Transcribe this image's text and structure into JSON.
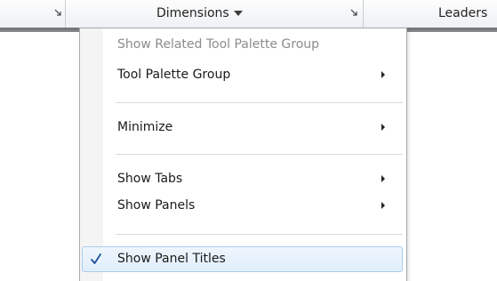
{
  "ribbon": {
    "panels": [
      {
        "title": "",
        "launcher_icon": "panel-launcher-icon"
      },
      {
        "title": "Dimensions",
        "dropdown_icon": "dropdown-arrow-icon",
        "launcher_icon": "panel-launcher-icon"
      },
      {
        "title": "Leaders"
      }
    ]
  },
  "context_menu": {
    "items": [
      {
        "label": "Show Related Tool Palette Group",
        "enabled": false,
        "submenu": false,
        "checked": false
      },
      {
        "label": "Tool Palette Group",
        "enabled": true,
        "submenu": true,
        "checked": false
      },
      {
        "label": "Minimize",
        "enabled": true,
        "submenu": true,
        "checked": false
      },
      {
        "label": "Show Tabs",
        "enabled": true,
        "submenu": true,
        "checked": false
      },
      {
        "label": "Show Panels",
        "enabled": true,
        "submenu": true,
        "checked": false
      },
      {
        "label": "Show Panel Titles",
        "enabled": true,
        "submenu": false,
        "checked": true,
        "highlighted": true
      }
    ],
    "check_icon": "checkmark-icon",
    "submenu_icon": "submenu-arrow-icon"
  },
  "colors": {
    "check": "#1f4f9a",
    "highlight_border": "#a9cdee",
    "disabled_text": "#8c8c8c"
  }
}
